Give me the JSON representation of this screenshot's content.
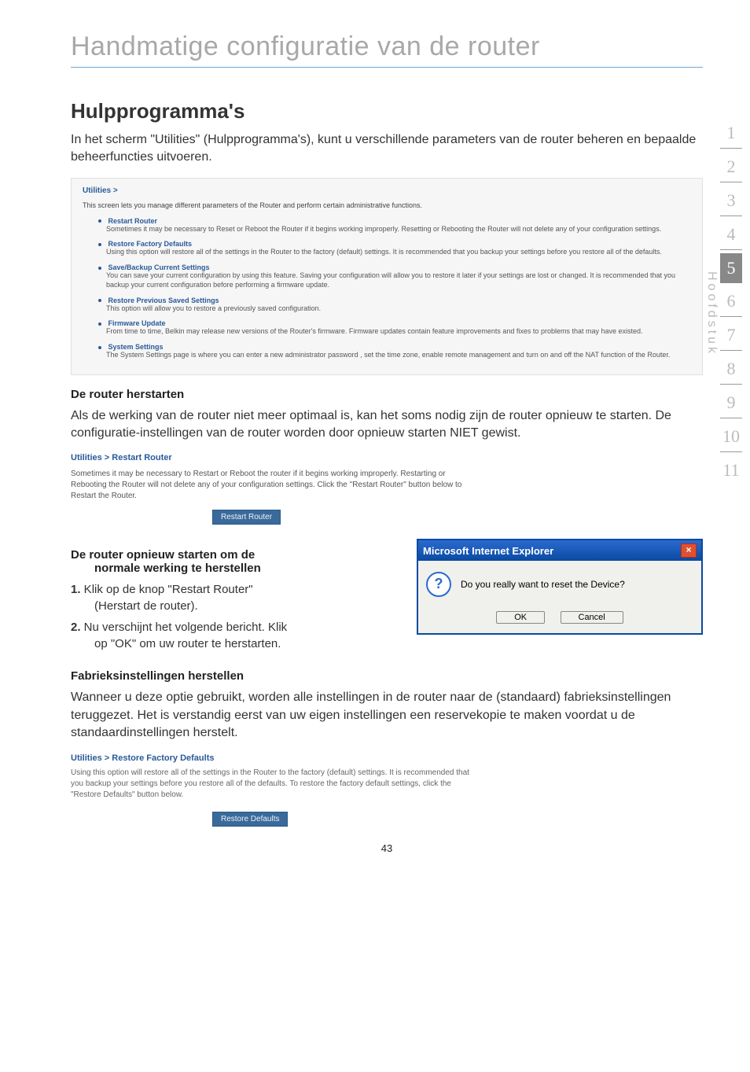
{
  "header": {
    "title": "Handmatige configuratie van de router"
  },
  "main": {
    "section_title": "Hulpprogramma's",
    "intro": "In het scherm \"Utilities\" (Hulpprogramma's), kunt u verschillende parameters van de router beheren en bepaalde beheerfuncties uitvoeren.",
    "utilities_panel": {
      "breadcrumb": "Utilities >",
      "intro": "This screen lets you manage different parameters of the Router and perform certain administrative functions.",
      "items": [
        {
          "title": "Restart Router",
          "desc": "Sometimes it may be necessary to Reset or Reboot the Router if it begins working improperly. Resetting or Rebooting the Router will not delete any of your configuration settings."
        },
        {
          "title": "Restore Factory Defaults",
          "desc": "Using this option will restore all of the settings in the Router to the factory (default) settings. It is recommended that you backup your settings before you restore all of the defaults."
        },
        {
          "title": "Save/Backup Current Settings",
          "desc": "You can save your current configuration by using this feature. Saving your configuration will allow you to restore it later if your settings are lost or changed. It is recommended that you backup your current configuration before performing a firmware update."
        },
        {
          "title": "Restore Previous Saved Settings",
          "desc": "This option will allow you to restore a previously saved configuration."
        },
        {
          "title": "Firmware Update",
          "desc": "From time to time, Belkin may release new versions of the Router's firmware. Firmware updates contain feature improvements and fixes to problems that may have existed."
        },
        {
          "title": "System Settings",
          "desc": "The System Settings page is where you can enter a new administrator password , set the time zone, enable remote management and turn on and off the NAT function of the Router."
        }
      ]
    },
    "restart_heading": "De router herstarten",
    "restart_text": "Als de werking van de router niet meer optimaal is, kan het soms nodig zijn de router opnieuw te starten. De configuratie-instellingen van de router worden door opnieuw starten NIET gewist.",
    "restart_panel": {
      "title": "Utilities > Restart Router",
      "text": "Sometimes it may be necessary to Restart or Reboot the router if it begins working improperly. Restarting or Rebooting the Router will not delete any of your configuration settings. Click the \"Restart Router\" button below to Restart the Router.",
      "button": "Restart Router"
    },
    "restart_normal_heading": "De router opnieuw starten om de",
    "restart_normal_heading2": "normale werking te herstellen",
    "step1_num": "1.",
    "step1_text": " Klik op de knop \"Restart Router\"",
    "step1_sub": "(Herstart de router).",
    "step2_num": "2.",
    "step2_text": " Nu verschijnt het volgende bericht. Klik",
    "step2_sub": "op \"OK\" om uw router te herstarten.",
    "dialog": {
      "title": "Microsoft Internet Explorer",
      "message": "Do you really want to reset the Device?",
      "ok": "OK",
      "cancel": "Cancel"
    },
    "factory_heading": "Fabrieksinstellingen herstellen",
    "factory_text": "Wanneer u deze optie gebruikt, worden alle instellingen in de router naar de (standaard) fabrieksinstellingen teruggezet. Het is verstandig eerst van uw eigen instellingen een reservekopie te maken voordat u de standaardinstellingen herstelt.",
    "restore_panel": {
      "title": "Utilities > Restore Factory Defaults",
      "text": "Using this option will restore all of the settings in the Router to the factory (default) settings. It is recommended that you backup your settings before you restore all of the defaults. To restore the factory default settings, click the \"Restore Defaults\" button below.",
      "button": "Restore Defaults"
    }
  },
  "sidenav": {
    "items": [
      "1",
      "2",
      "3",
      "4",
      "5",
      "6",
      "7",
      "8",
      "9",
      "10",
      "11"
    ],
    "active_index": 4,
    "label": "Hoofdstuk"
  },
  "page_number": "43"
}
